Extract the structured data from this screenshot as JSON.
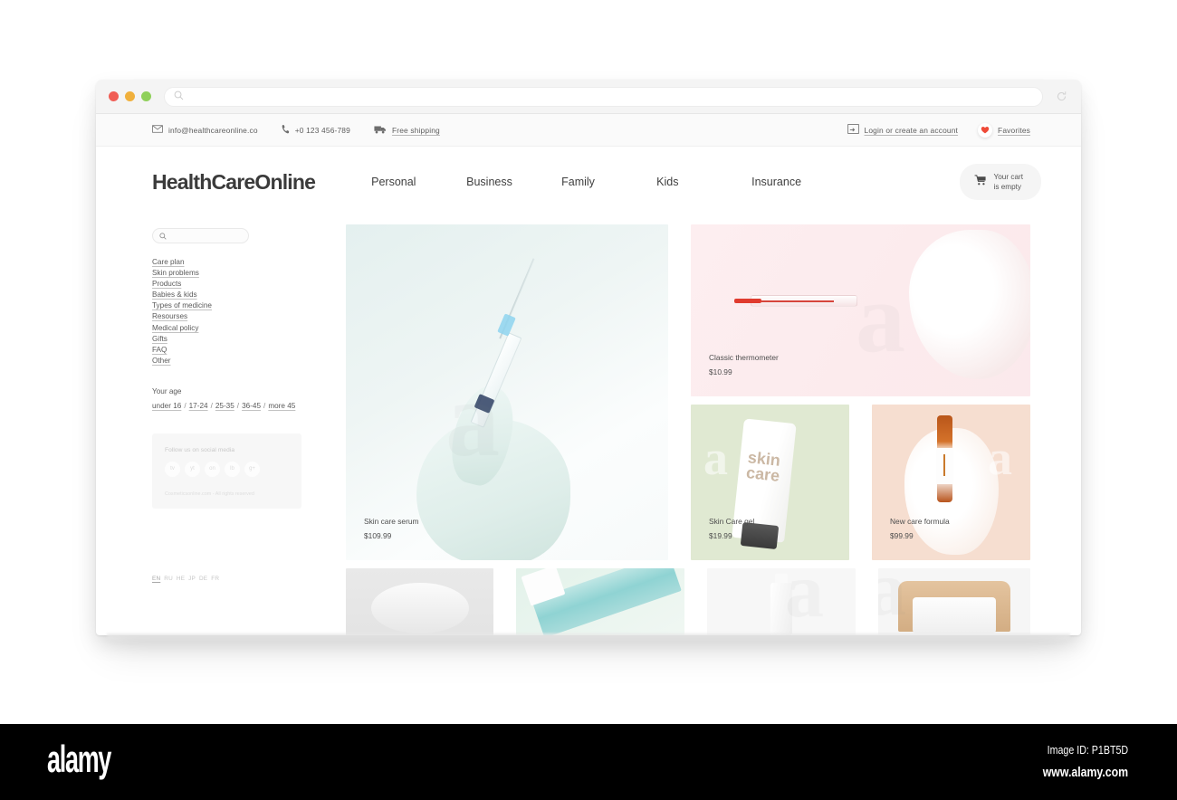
{
  "browser": {
    "url_value": "",
    "url_placeholder": "",
    "search_icon": "search-icon",
    "reload_icon": "reload-icon",
    "lights": [
      "close",
      "minimize",
      "maximize"
    ]
  },
  "utilbar": {
    "email": "info@healthcareonline.co",
    "phone": "+0 123 456-789",
    "shipping": "Free shipping",
    "login": "Login or create an account",
    "favorites": "Favorites",
    "heart_color": "#ef4a38"
  },
  "header": {
    "logo": "HealthCareOnline",
    "nav": [
      {
        "label": "Personal"
      },
      {
        "label": "Business"
      },
      {
        "label": "Family"
      },
      {
        "label": "Kids"
      },
      {
        "label": "Insurance"
      }
    ],
    "cart": {
      "line1": "Your cart",
      "line2": "is empty"
    }
  },
  "sidebar": {
    "search_value": "",
    "search_placeholder": "",
    "links": [
      {
        "label": "Care plan"
      },
      {
        "label": "Skin problems"
      },
      {
        "label": "Products"
      },
      {
        "label": "Babies & kids"
      },
      {
        "label": "Types of medicine"
      },
      {
        "label": "Resourses"
      },
      {
        "label": "Medical policy"
      },
      {
        "label": "Gifts"
      },
      {
        "label": "FAQ"
      },
      {
        "label": "Other"
      }
    ],
    "age": {
      "title": "Your age",
      "options": [
        "under 16",
        "17-24",
        "25-35",
        "36-45",
        "more 45"
      ],
      "separator": "/"
    },
    "social": {
      "title": "Follow us on social media",
      "icons": [
        "tv",
        "yt",
        "on",
        "lb",
        "g+"
      ],
      "copyright": "Cosmeticsonline.com - All rights reserved"
    },
    "languages": [
      "EN",
      "RU",
      "HE",
      "JP",
      "DE",
      "FR"
    ],
    "active_language": "EN"
  },
  "products": {
    "serum": {
      "name": "Skin care serum",
      "price": "$109.99",
      "bg": "#edf5f4"
    },
    "thermo": {
      "name": "Classic thermometer",
      "price": "$10.99",
      "bg": "#fceced"
    },
    "gel": {
      "name": "Skin Care gel",
      "price": "$19.99",
      "bg": "#e0e9d2"
    },
    "formula": {
      "name": "New care formula",
      "price": "$99.99",
      "bg": "#f6ded0"
    }
  },
  "watermark": {
    "brand": "alamy",
    "image_id": "Image ID: P1BT5D",
    "url": "www.alamy.com",
    "letter": "a"
  }
}
